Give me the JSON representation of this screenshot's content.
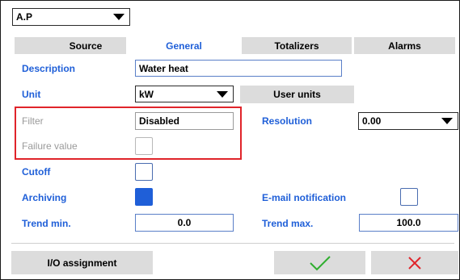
{
  "header": {
    "device_select": "A.P"
  },
  "tabs": [
    {
      "label": "Source",
      "active": false
    },
    {
      "label": "General",
      "active": true
    },
    {
      "label": "Totalizers",
      "active": false
    },
    {
      "label": "Alarms",
      "active": false
    }
  ],
  "form": {
    "description_label": "Description",
    "description_value": "Water heat",
    "unit_label": "Unit",
    "unit_value": "kW",
    "user_units_button": "User units",
    "filter_label": "Filter",
    "filter_value": "Disabled",
    "failure_value_label": "Failure value",
    "failure_value_checked": false,
    "resolution_label": "Resolution",
    "resolution_value": "0.00",
    "cutoff_label": "Cutoff",
    "cutoff_checked": false,
    "archiving_label": "Archiving",
    "archiving_checked": true,
    "email_label": "E-mail notification",
    "email_checked": false,
    "trend_min_label": "Trend min.",
    "trend_min_value": "0.0",
    "trend_max_label": "Trend max.",
    "trend_max_value": "100.0"
  },
  "footer": {
    "io_assignment_button": "I/O assignment"
  },
  "colors": {
    "accent": "#1f5fd8",
    "highlight": "#e0242a",
    "confirm": "#2fae2f",
    "cancel": "#e0242a"
  },
  "icons": {
    "confirm": "checkmark-icon",
    "cancel": "close-icon",
    "dropdown": "chevron-down-icon"
  }
}
